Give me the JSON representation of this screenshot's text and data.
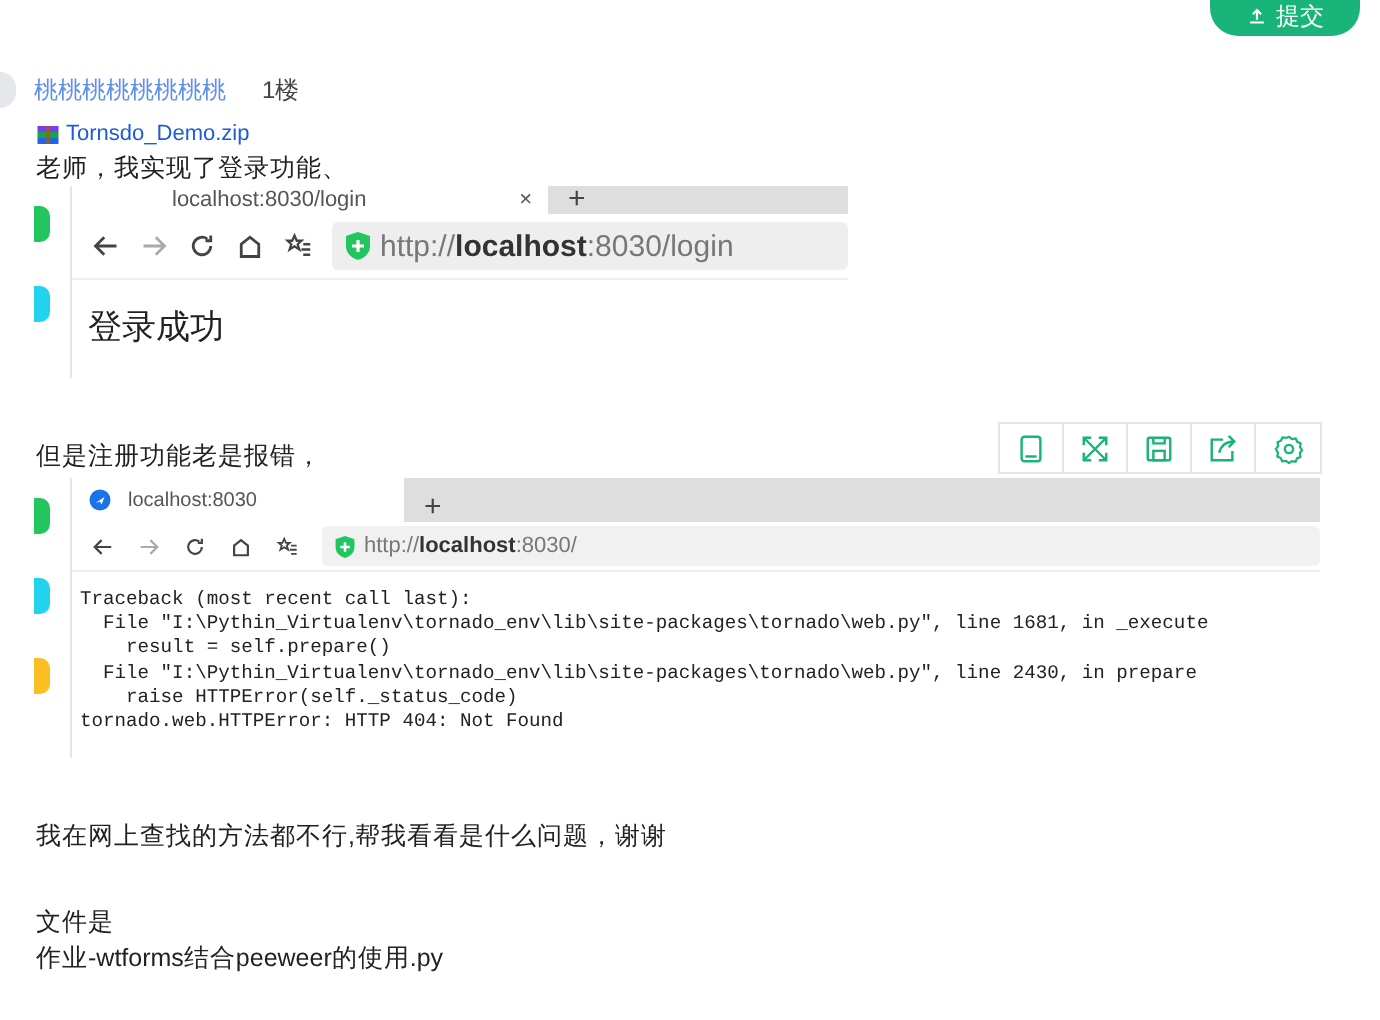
{
  "submit_button": {
    "label": "提交"
  },
  "post": {
    "author": "桃桃桃桃桃桃桃桃",
    "floor": "1楼",
    "attachment": {
      "name": "Tornsdo_Demo.zip"
    },
    "blocks": [
      {
        "kind": "text",
        "text": "老师，我实现了登录功能、"
      },
      {
        "kind": "screenshot",
        "strip_icons": [
          {
            "color": "#22c55e"
          },
          {
            "color": "#22d3ee"
          }
        ],
        "tab_title": "localhost:8030/login",
        "tab_close": "×",
        "new_tab": "+",
        "url": "http://**localhost**:8030/login",
        "body": [
          "登录成功"
        ]
      },
      {
        "kind": "text",
        "text": "但是注册功能老是报错，",
        "toolbar": true
      },
      {
        "kind": "screenshot",
        "strip_icons": [
          {
            "color": "#22c55e"
          },
          {
            "color": "#22d3ee"
          },
          {
            "color": "#fbbf24"
          }
        ],
        "tab_title": "localhost:8030",
        "new_tab": "+",
        "url": "http://**localhost**:8030/",
        "body": [
          "Traceback (most recent call last):",
          "  File \"I:\\Pythin_Virtualenv\\tornado_env\\lib\\site-packages\\tornado\\web.py\", line 1681, in _execute",
          "    result = self.prepare()",
          "  File \"I:\\Pythin_Virtualenv\\tornado_env\\lib\\site-packages\\tornado\\web.py\", line 2430, in prepare",
          "    raise HTTPError(self._status_code)",
          "tornado.web.HTTPError: HTTP 404: Not Found"
        ]
      },
      {
        "kind": "text",
        "text": "我在网上查找的方法都不行,帮我看看是什么问题，谢谢"
      },
      {
        "kind": "gap"
      },
      {
        "kind": "text",
        "text": "文件是"
      },
      {
        "kind": "text",
        "text": "作业-wtforms结合peeweer的使用.py"
      }
    ]
  }
}
